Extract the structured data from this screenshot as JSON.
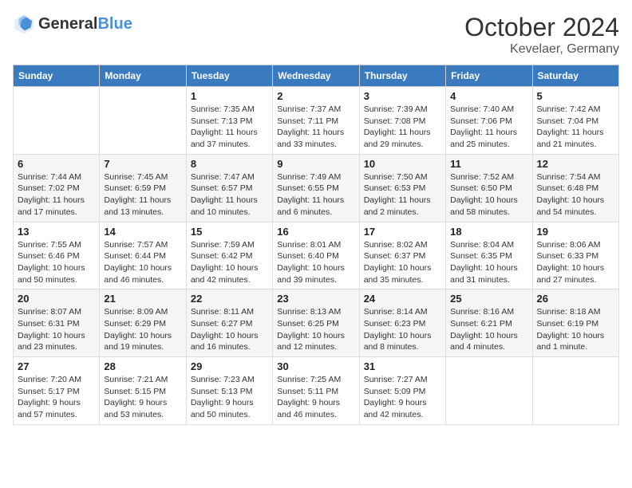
{
  "header": {
    "logo_general": "General",
    "logo_blue": "Blue",
    "month": "October 2024",
    "location": "Kevelaer, Germany"
  },
  "weekdays": [
    "Sunday",
    "Monday",
    "Tuesday",
    "Wednesday",
    "Thursday",
    "Friday",
    "Saturday"
  ],
  "weeks": [
    [
      {
        "day": "",
        "sunrise": "",
        "sunset": "",
        "daylight": ""
      },
      {
        "day": "",
        "sunrise": "",
        "sunset": "",
        "daylight": ""
      },
      {
        "day": "1",
        "sunrise": "Sunrise: 7:35 AM",
        "sunset": "Sunset: 7:13 PM",
        "daylight": "Daylight: 11 hours and 37 minutes."
      },
      {
        "day": "2",
        "sunrise": "Sunrise: 7:37 AM",
        "sunset": "Sunset: 7:11 PM",
        "daylight": "Daylight: 11 hours and 33 minutes."
      },
      {
        "day": "3",
        "sunrise": "Sunrise: 7:39 AM",
        "sunset": "Sunset: 7:08 PM",
        "daylight": "Daylight: 11 hours and 29 minutes."
      },
      {
        "day": "4",
        "sunrise": "Sunrise: 7:40 AM",
        "sunset": "Sunset: 7:06 PM",
        "daylight": "Daylight: 11 hours and 25 minutes."
      },
      {
        "day": "5",
        "sunrise": "Sunrise: 7:42 AM",
        "sunset": "Sunset: 7:04 PM",
        "daylight": "Daylight: 11 hours and 21 minutes."
      }
    ],
    [
      {
        "day": "6",
        "sunrise": "Sunrise: 7:44 AM",
        "sunset": "Sunset: 7:02 PM",
        "daylight": "Daylight: 11 hours and 17 minutes."
      },
      {
        "day": "7",
        "sunrise": "Sunrise: 7:45 AM",
        "sunset": "Sunset: 6:59 PM",
        "daylight": "Daylight: 11 hours and 13 minutes."
      },
      {
        "day": "8",
        "sunrise": "Sunrise: 7:47 AM",
        "sunset": "Sunset: 6:57 PM",
        "daylight": "Daylight: 11 hours and 10 minutes."
      },
      {
        "day": "9",
        "sunrise": "Sunrise: 7:49 AM",
        "sunset": "Sunset: 6:55 PM",
        "daylight": "Daylight: 11 hours and 6 minutes."
      },
      {
        "day": "10",
        "sunrise": "Sunrise: 7:50 AM",
        "sunset": "Sunset: 6:53 PM",
        "daylight": "Daylight: 11 hours and 2 minutes."
      },
      {
        "day": "11",
        "sunrise": "Sunrise: 7:52 AM",
        "sunset": "Sunset: 6:50 PM",
        "daylight": "Daylight: 10 hours and 58 minutes."
      },
      {
        "day": "12",
        "sunrise": "Sunrise: 7:54 AM",
        "sunset": "Sunset: 6:48 PM",
        "daylight": "Daylight: 10 hours and 54 minutes."
      }
    ],
    [
      {
        "day": "13",
        "sunrise": "Sunrise: 7:55 AM",
        "sunset": "Sunset: 6:46 PM",
        "daylight": "Daylight: 10 hours and 50 minutes."
      },
      {
        "day": "14",
        "sunrise": "Sunrise: 7:57 AM",
        "sunset": "Sunset: 6:44 PM",
        "daylight": "Daylight: 10 hours and 46 minutes."
      },
      {
        "day": "15",
        "sunrise": "Sunrise: 7:59 AM",
        "sunset": "Sunset: 6:42 PM",
        "daylight": "Daylight: 10 hours and 42 minutes."
      },
      {
        "day": "16",
        "sunrise": "Sunrise: 8:01 AM",
        "sunset": "Sunset: 6:40 PM",
        "daylight": "Daylight: 10 hours and 39 minutes."
      },
      {
        "day": "17",
        "sunrise": "Sunrise: 8:02 AM",
        "sunset": "Sunset: 6:37 PM",
        "daylight": "Daylight: 10 hours and 35 minutes."
      },
      {
        "day": "18",
        "sunrise": "Sunrise: 8:04 AM",
        "sunset": "Sunset: 6:35 PM",
        "daylight": "Daylight: 10 hours and 31 minutes."
      },
      {
        "day": "19",
        "sunrise": "Sunrise: 8:06 AM",
        "sunset": "Sunset: 6:33 PM",
        "daylight": "Daylight: 10 hours and 27 minutes."
      }
    ],
    [
      {
        "day": "20",
        "sunrise": "Sunrise: 8:07 AM",
        "sunset": "Sunset: 6:31 PM",
        "daylight": "Daylight: 10 hours and 23 minutes."
      },
      {
        "day": "21",
        "sunrise": "Sunrise: 8:09 AM",
        "sunset": "Sunset: 6:29 PM",
        "daylight": "Daylight: 10 hours and 19 minutes."
      },
      {
        "day": "22",
        "sunrise": "Sunrise: 8:11 AM",
        "sunset": "Sunset: 6:27 PM",
        "daylight": "Daylight: 10 hours and 16 minutes."
      },
      {
        "day": "23",
        "sunrise": "Sunrise: 8:13 AM",
        "sunset": "Sunset: 6:25 PM",
        "daylight": "Daylight: 10 hours and 12 minutes."
      },
      {
        "day": "24",
        "sunrise": "Sunrise: 8:14 AM",
        "sunset": "Sunset: 6:23 PM",
        "daylight": "Daylight: 10 hours and 8 minutes."
      },
      {
        "day": "25",
        "sunrise": "Sunrise: 8:16 AM",
        "sunset": "Sunset: 6:21 PM",
        "daylight": "Daylight: 10 hours and 4 minutes."
      },
      {
        "day": "26",
        "sunrise": "Sunrise: 8:18 AM",
        "sunset": "Sunset: 6:19 PM",
        "daylight": "Daylight: 10 hours and 1 minute."
      }
    ],
    [
      {
        "day": "27",
        "sunrise": "Sunrise: 7:20 AM",
        "sunset": "Sunset: 5:17 PM",
        "daylight": "Daylight: 9 hours and 57 minutes."
      },
      {
        "day": "28",
        "sunrise": "Sunrise: 7:21 AM",
        "sunset": "Sunset: 5:15 PM",
        "daylight": "Daylight: 9 hours and 53 minutes."
      },
      {
        "day": "29",
        "sunrise": "Sunrise: 7:23 AM",
        "sunset": "Sunset: 5:13 PM",
        "daylight": "Daylight: 9 hours and 50 minutes."
      },
      {
        "day": "30",
        "sunrise": "Sunrise: 7:25 AM",
        "sunset": "Sunset: 5:11 PM",
        "daylight": "Daylight: 9 hours and 46 minutes."
      },
      {
        "day": "31",
        "sunrise": "Sunrise: 7:27 AM",
        "sunset": "Sunset: 5:09 PM",
        "daylight": "Daylight: 9 hours and 42 minutes."
      },
      {
        "day": "",
        "sunrise": "",
        "sunset": "",
        "daylight": ""
      },
      {
        "day": "",
        "sunrise": "",
        "sunset": "",
        "daylight": ""
      }
    ]
  ]
}
